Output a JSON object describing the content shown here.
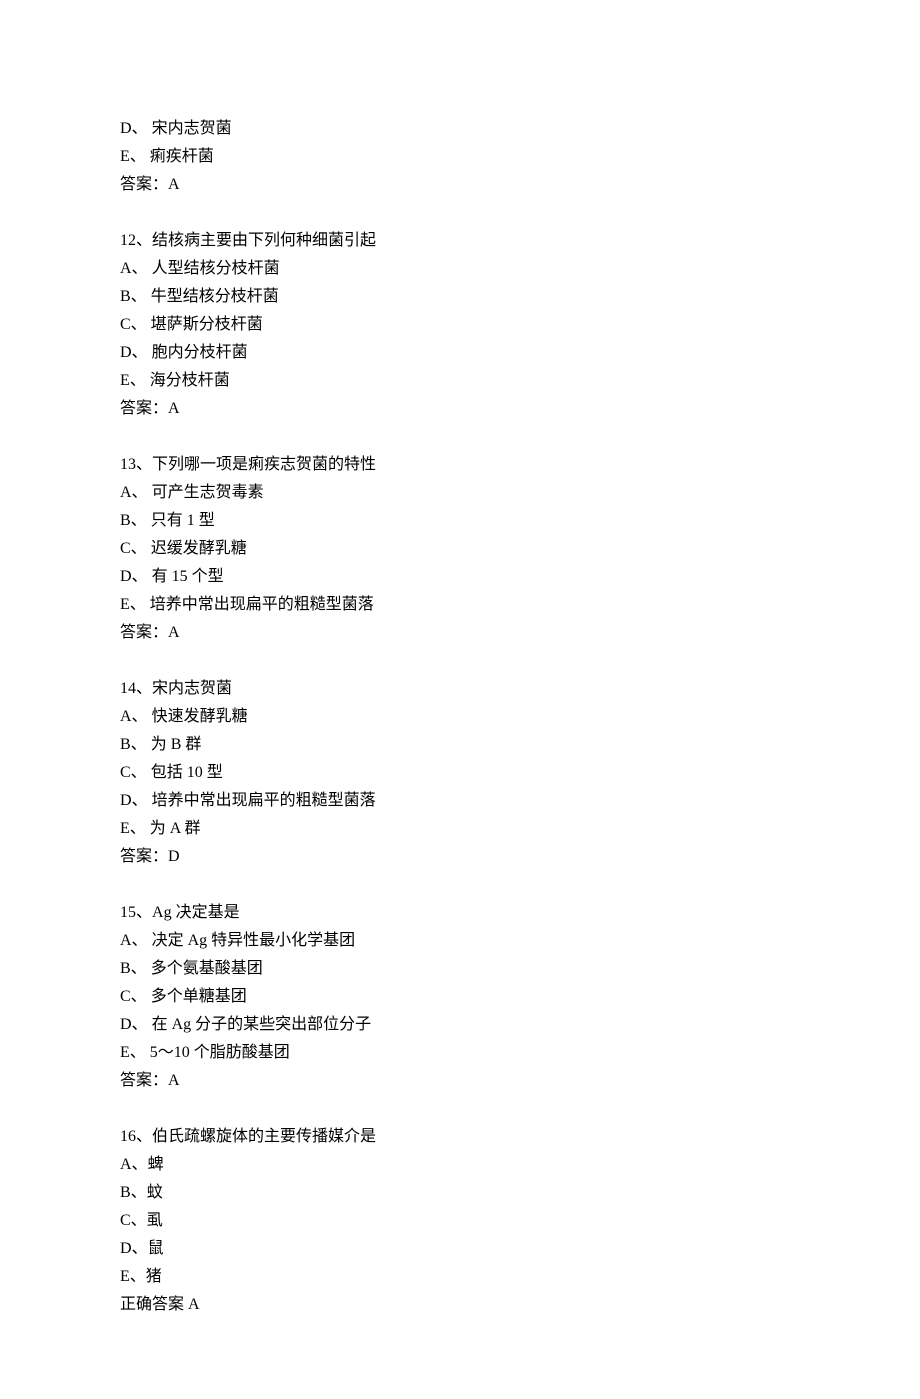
{
  "leading": [
    {
      "label": "D、",
      "text": "宋内志贺菌"
    },
    {
      "label": "E、",
      "text": "痢疾杆菌"
    }
  ],
  "leading_answer": "答案：A",
  "questions": [
    {
      "number": "12、",
      "stem": "结核病主要由下列何种细菌引起",
      "options": [
        {
          "label": "A、",
          "text": "人型结核分枝杆菌"
        },
        {
          "label": "B、",
          "text": "牛型结核分枝杆菌"
        },
        {
          "label": "C、",
          "text": "堪萨斯分枝杆菌"
        },
        {
          "label": "D、",
          "text": "胞内分枝杆菌"
        },
        {
          "label": "E、",
          "text": "海分枝杆菌"
        }
      ],
      "answer": "答案：A"
    },
    {
      "number": "13、",
      "stem": "下列哪一项是痢疾志贺菌的特性",
      "options": [
        {
          "label": "A、",
          "text": "可产生志贺毒素"
        },
        {
          "label": "B、",
          "text": "只有 1 型"
        },
        {
          "label": "C、",
          "text": "迟缓发酵乳糖"
        },
        {
          "label": "D、",
          "text": "有 15 个型"
        },
        {
          "label": "E、",
          "text": "培养中常出现扁平的粗糙型菌落"
        }
      ],
      "answer": "答案：A"
    },
    {
      "number": "14、",
      "stem": "宋内志贺菌",
      "options": [
        {
          "label": "A、",
          "text": "快速发酵乳糖"
        },
        {
          "label": "B、",
          "text": "为 B 群"
        },
        {
          "label": "C、",
          "text": "包括 10 型"
        },
        {
          "label": "D、",
          "text": "培养中常出现扁平的粗糙型菌落"
        },
        {
          "label": "E、",
          "text": "为 A 群"
        }
      ],
      "answer": "答案：D"
    },
    {
      "number": "15、",
      "stem": "Ag 决定基是",
      "options": [
        {
          "label": "A、",
          "text": "决定 Ag 特异性最小化学基团"
        },
        {
          "label": "B、",
          "text": "多个氨基酸基团"
        },
        {
          "label": "C、",
          "text": "多个单糖基团"
        },
        {
          "label": "D、",
          "text": "在 Ag 分子的某些突出部位分子"
        },
        {
          "label": "E、",
          "text": "5～10 个脂肪酸基团"
        }
      ],
      "answer": "答案：A"
    },
    {
      "number": "16、",
      "stem": "伯氏疏螺旋体的主要传播媒介是",
      "options": [
        {
          "label": "A、",
          "text": "蜱"
        },
        {
          "label": "B、",
          "text": "蚊"
        },
        {
          "label": "C、",
          "text": "虱"
        },
        {
          "label": "D、",
          "text": "鼠"
        },
        {
          "label": "E、",
          "text": "猪"
        }
      ],
      "answer": "正确答案 A"
    }
  ]
}
